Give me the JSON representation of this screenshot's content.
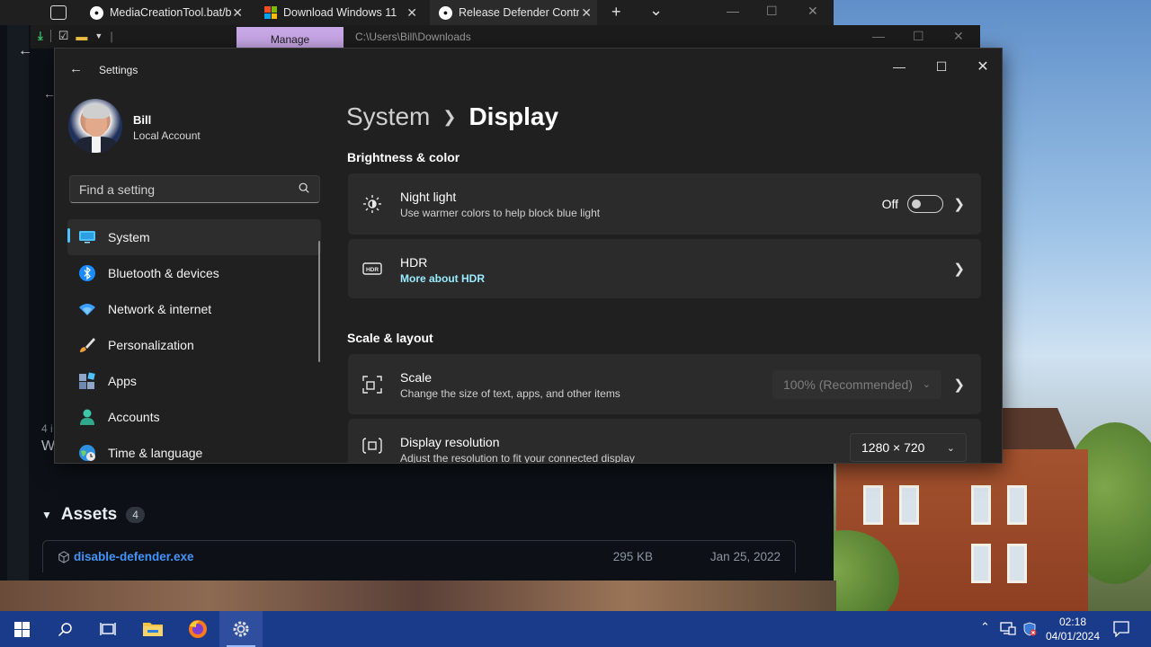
{
  "browser": {
    "tabs": [
      {
        "title": "MediaCreationTool.bat/b",
        "icon": "github-icon"
      },
      {
        "title": "Download Windows 11",
        "icon": "microsoft-icon"
      },
      {
        "title": "Release Defender Control",
        "icon": "github-icon"
      }
    ],
    "new_tab": "+",
    "tab_list": "⌄",
    "page": {
      "frag1": "4 i",
      "frag2": "W",
      "assets_title": "Assets",
      "assets_count": "4",
      "asset": {
        "name": "disable-defender.exe",
        "size": "295 KB",
        "date": "Jan 25, 2022"
      }
    }
  },
  "explorer": {
    "ribbon_tab": "Manage",
    "path": "C:\\Users\\Bill\\Downloads"
  },
  "settings": {
    "app_title": "Settings",
    "profile": {
      "name": "Bill",
      "account_type": "Local Account"
    },
    "search": {
      "placeholder": "Find a setting"
    },
    "nav": [
      {
        "label": "System",
        "icon": "system-icon",
        "active": true
      },
      {
        "label": "Bluetooth & devices",
        "icon": "bluetooth-icon"
      },
      {
        "label": "Network & internet",
        "icon": "wifi-icon"
      },
      {
        "label": "Personalization",
        "icon": "brush-icon"
      },
      {
        "label": "Apps",
        "icon": "apps-icon"
      },
      {
        "label": "Accounts",
        "icon": "person-icon"
      },
      {
        "label": "Time & language",
        "icon": "globe-clock-icon"
      }
    ],
    "breadcrumb": {
      "parent": "System",
      "current": "Display"
    },
    "sections": {
      "brightness": "Brightness & color",
      "scale_layout": "Scale & layout"
    },
    "night_light": {
      "title": "Night light",
      "subtitle": "Use warmer colors to help block blue light",
      "state": "Off"
    },
    "hdr": {
      "title": "HDR",
      "link": "More about HDR"
    },
    "scale": {
      "title": "Scale",
      "subtitle": "Change the size of text, apps, and other items",
      "value": "100% (Recommended)"
    },
    "resolution": {
      "title": "Display resolution",
      "subtitle": "Adjust the resolution to fit your connected display",
      "value": "1280 × 720"
    }
  },
  "taskbar": {
    "time": "02:18",
    "date": "04/01/2024"
  },
  "colors": {
    "accent": "#4cc2ff",
    "link": "#99ebff",
    "taskbar": "#1a3a8a",
    "github_link": "#4493f8"
  }
}
